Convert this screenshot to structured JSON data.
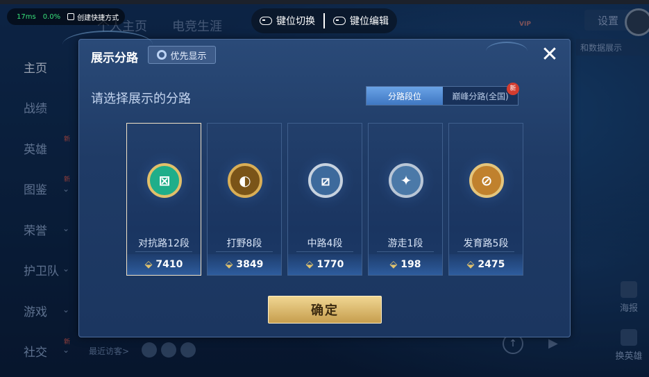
{
  "status_overlay": {
    "latency": "17ms",
    "loss": "0.0%",
    "shortcut_label": "创建快捷方式"
  },
  "keybar": {
    "switch_label": "键位切换",
    "edit_label": "键位编辑"
  },
  "background": {
    "tabs": [
      "个人主页",
      "电竞生涯"
    ],
    "settings_label": "设置",
    "vip_label": "VIP",
    "link_label": "和数据展示",
    "right_icons": [
      {
        "label": "海报"
      },
      {
        "label": "换英雄"
      }
    ]
  },
  "leftnav": {
    "items": [
      {
        "label": "主页",
        "active": true
      },
      {
        "label": "战绩"
      },
      {
        "label": "英雄",
        "badge": "新"
      },
      {
        "label": "图鉴",
        "badge": "新"
      },
      {
        "label": "荣誉"
      },
      {
        "label": "护卫队"
      },
      {
        "label": "游戏"
      },
      {
        "label": "社交",
        "badge": "新"
      }
    ],
    "visitor_label": "最近访客>"
  },
  "dialog": {
    "title": "展示分路",
    "priority_label": "优先显示",
    "subtitle": "请选择展示的分路",
    "segments": [
      {
        "label": "分路段位",
        "selected": true
      },
      {
        "label": "巅峰分路(全国)",
        "badge": "新"
      }
    ],
    "cards": [
      {
        "label": "对抗路12段",
        "score": "7410",
        "emblem": "green",
        "selected": true
      },
      {
        "label": "打野8段",
        "score": "3849",
        "emblem": "gold"
      },
      {
        "label": "中路4段",
        "score": "1770",
        "emblem": "silver"
      },
      {
        "label": "游走1段",
        "score": "198",
        "emblem": "blue"
      },
      {
        "label": "发育路5段",
        "score": "2475",
        "emblem": "orange"
      }
    ],
    "confirm_label": "确定"
  },
  "colors": {
    "accent_gold": "#d7b05a",
    "selected_border": "#f2e3c8",
    "segment_active": "#4f86d0"
  }
}
